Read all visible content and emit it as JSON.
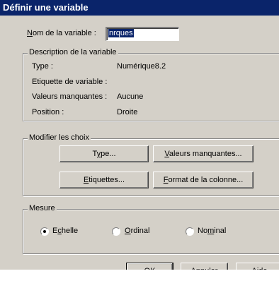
{
  "window": {
    "title": "Définir une variable"
  },
  "name_field": {
    "label_prefix": "N",
    "label_rest": "om de la variable :",
    "value": "nrques"
  },
  "description": {
    "legend": "Description de la variable",
    "rows": [
      {
        "label": "Type :",
        "value": "Numérique8.2"
      },
      {
        "label": "Etiquette de variable :",
        "value": ""
      },
      {
        "label": "Valeurs manquantes :",
        "value": "Aucune"
      },
      {
        "label": "Position :",
        "value": "Droite"
      }
    ]
  },
  "modify": {
    "legend": "Modifier les choix",
    "type_btn": {
      "pre": "T",
      "u": "y",
      "post": "pe..."
    },
    "missing_btn": {
      "u": "V",
      "post": "aleurs manquantes..."
    },
    "labels_btn": {
      "u": "E",
      "post": "tiquettes..."
    },
    "format_btn": {
      "u": "F",
      "post": "ormat de la colonne..."
    }
  },
  "measure": {
    "legend": "Mesure",
    "options": [
      {
        "pre": "E",
        "u": "c",
        "post": "helle",
        "checked": true
      },
      {
        "pre": "",
        "u": "O",
        "post": "rdinal",
        "checked": false
      },
      {
        "pre": "No",
        "u": "m",
        "post": "inal",
        "checked": false
      }
    ]
  },
  "buttons": {
    "ok": "OK",
    "cancel": "Annuler",
    "help": "Aide"
  }
}
